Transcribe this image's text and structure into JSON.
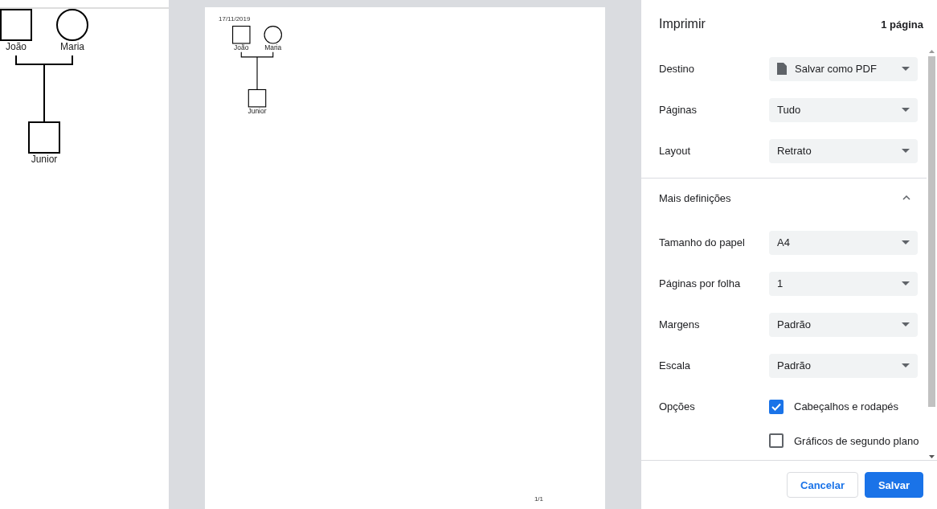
{
  "canvas": {
    "people": [
      {
        "name": "João",
        "kind": "male"
      },
      {
        "name": "Maria",
        "kind": "female"
      },
      {
        "name": "Junior",
        "kind": "male"
      }
    ]
  },
  "preview": {
    "header_date": "17/11/2019",
    "people": [
      {
        "name": "João",
        "kind": "male"
      },
      {
        "name": "Maria",
        "kind": "female"
      },
      {
        "name": "Junior",
        "kind": "male"
      }
    ],
    "page_number": "1/1"
  },
  "print_panel": {
    "title": "Imprimir",
    "page_count": "1 página",
    "settings": [
      {
        "label": "Destino",
        "value": "Salvar como PDF",
        "kind": "pdf"
      },
      {
        "label": "Páginas",
        "value": "Tudo",
        "kind": "plain"
      },
      {
        "label": "Layout",
        "value": "Retrato",
        "kind": "plain"
      }
    ],
    "more_settings": {
      "label": "Mais definições",
      "expanded": true
    },
    "more": [
      {
        "label": "Tamanho do papel",
        "value": "A4",
        "kind": "plain"
      },
      {
        "label": "Páginas por folha",
        "value": "1",
        "kind": "plain"
      },
      {
        "label": "Margens",
        "value": "Padrão",
        "kind": "plain"
      },
      {
        "label": "Escala",
        "value": "Padrão",
        "kind": "plain"
      }
    ],
    "options": {
      "label": "Opções",
      "checkboxes": [
        {
          "label": "Cabeçalhos e rodapés",
          "checked": true
        },
        {
          "label": "Gráficos de segundo plano",
          "checked": false
        }
      ]
    },
    "buttons": [
      {
        "label": "Cancelar",
        "kind": "secondary"
      },
      {
        "label": "Salvar",
        "kind": "primary"
      }
    ]
  }
}
